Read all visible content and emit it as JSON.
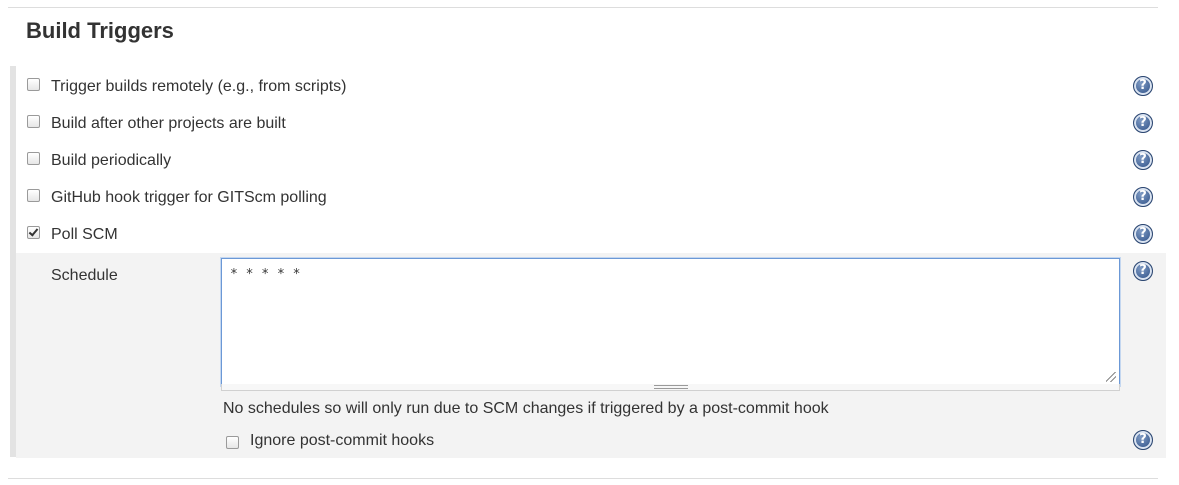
{
  "section": {
    "title": "Build Triggers"
  },
  "triggers": [
    {
      "label": "Trigger builds remotely (e.g., from scripts)",
      "checked": false
    },
    {
      "label": "Build after other projects are built",
      "checked": false
    },
    {
      "label": "Build periodically",
      "checked": false
    },
    {
      "label": "GitHub hook trigger for GITScm polling",
      "checked": false
    },
    {
      "label": "Poll SCM",
      "checked": true
    }
  ],
  "schedule": {
    "label": "Schedule",
    "value": "* * * * *",
    "note": "No schedules so will only run due to SCM changes if triggered by a post-commit hook",
    "ignore_hooks": {
      "label": "Ignore post-commit hooks",
      "checked": false
    }
  },
  "help": {
    "glyph": "?",
    "icon": "help-icon",
    "color": "#3e5f93"
  }
}
